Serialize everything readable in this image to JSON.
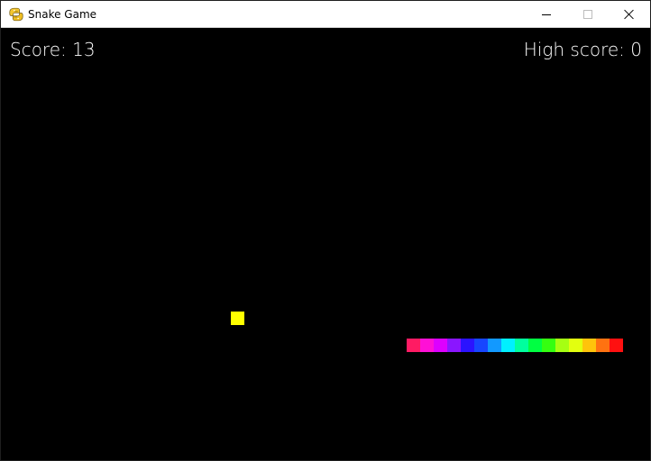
{
  "window": {
    "title": "Snake Game",
    "controls": {
      "minimize": "minimize",
      "maximize": "maximize",
      "close": "close"
    }
  },
  "hud": {
    "score": "Score: 13",
    "high_score": "High score: 0"
  },
  "game": {
    "background": "#000000",
    "food": {
      "color": "#ffff00",
      "cell": [
        17,
        21
      ]
    },
    "snake": {
      "segments": [
        {
          "cell": [
            30,
            23
          ],
          "color": "#ff1b63"
        },
        {
          "cell": [
            31,
            23
          ],
          "color": "#ff10d6"
        },
        {
          "cell": [
            32,
            23
          ],
          "color": "#dd00ff"
        },
        {
          "cell": [
            33,
            23
          ],
          "color": "#8a16ff"
        },
        {
          "cell": [
            34,
            23
          ],
          "color": "#2b13ff"
        },
        {
          "cell": [
            35,
            23
          ],
          "color": "#1746ff"
        },
        {
          "cell": [
            36,
            23
          ],
          "color": "#1299ff"
        },
        {
          "cell": [
            37,
            23
          ],
          "color": "#00f0ff"
        },
        {
          "cell": [
            38,
            23
          ],
          "color": "#00ff9e"
        },
        {
          "cell": [
            39,
            23
          ],
          "color": "#00ff42"
        },
        {
          "cell": [
            40,
            23
          ],
          "color": "#35ff11"
        },
        {
          "cell": [
            41,
            23
          ],
          "color": "#a6ff12"
        },
        {
          "cell": [
            42,
            23
          ],
          "color": "#e3ff0f"
        },
        {
          "cell": [
            43,
            23
          ],
          "color": "#ffc40b"
        },
        {
          "cell": [
            44,
            23
          ],
          "color": "#ff7211"
        },
        {
          "cell": [
            45,
            23
          ],
          "color": "#ff1010"
        }
      ]
    }
  },
  "icons": {
    "app": "python-icon",
    "minimize": "minimize-icon",
    "maximize": "maximize-icon",
    "close": "close-icon"
  }
}
